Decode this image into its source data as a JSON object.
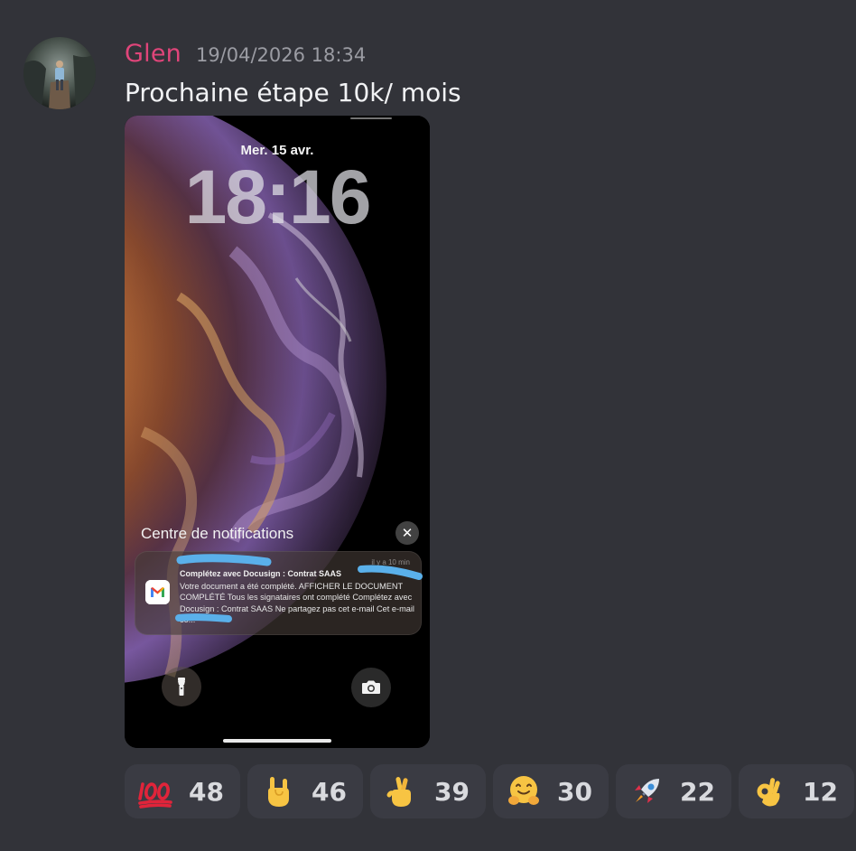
{
  "message": {
    "author": "Glen",
    "author_color": "#e0457a",
    "timestamp": "19/04/2026 18:34",
    "text": "Prochaine étape 10k/ mois",
    "avatar_icon": "user-avatar-photo"
  },
  "lockscreen": {
    "date": "Mer. 15 avr.",
    "time": "18:16",
    "notification_center_title": "Centre de notifications",
    "close_icon": "close-icon",
    "notification": {
      "app_icon": "gmail-icon",
      "time_ago": "il y a 10 min",
      "title": "Complétez avec Docusign : Contrat SAAS",
      "body": "Votre document a été complété. AFFICHER LE DOCUMENT COMPLÉTÉ Tous les signataires ont complété Complétez avec Docusign : Contrat SAAS Ne partagez pas cet e-mail Cet e-mail co..."
    },
    "flashlight_icon": "flashlight-icon",
    "camera_icon": "camera-icon"
  },
  "reactions": [
    {
      "emoji": "hundred-points-emoji",
      "count": "48"
    },
    {
      "emoji": "rock-on-hand-emoji",
      "count": "46"
    },
    {
      "emoji": "crossed-fingers-emoji",
      "count": "39"
    },
    {
      "emoji": "hugging-face-emoji",
      "count": "30"
    },
    {
      "emoji": "rocket-emoji",
      "count": "22"
    },
    {
      "emoji": "ok-hand-emoji",
      "count": "12"
    }
  ]
}
